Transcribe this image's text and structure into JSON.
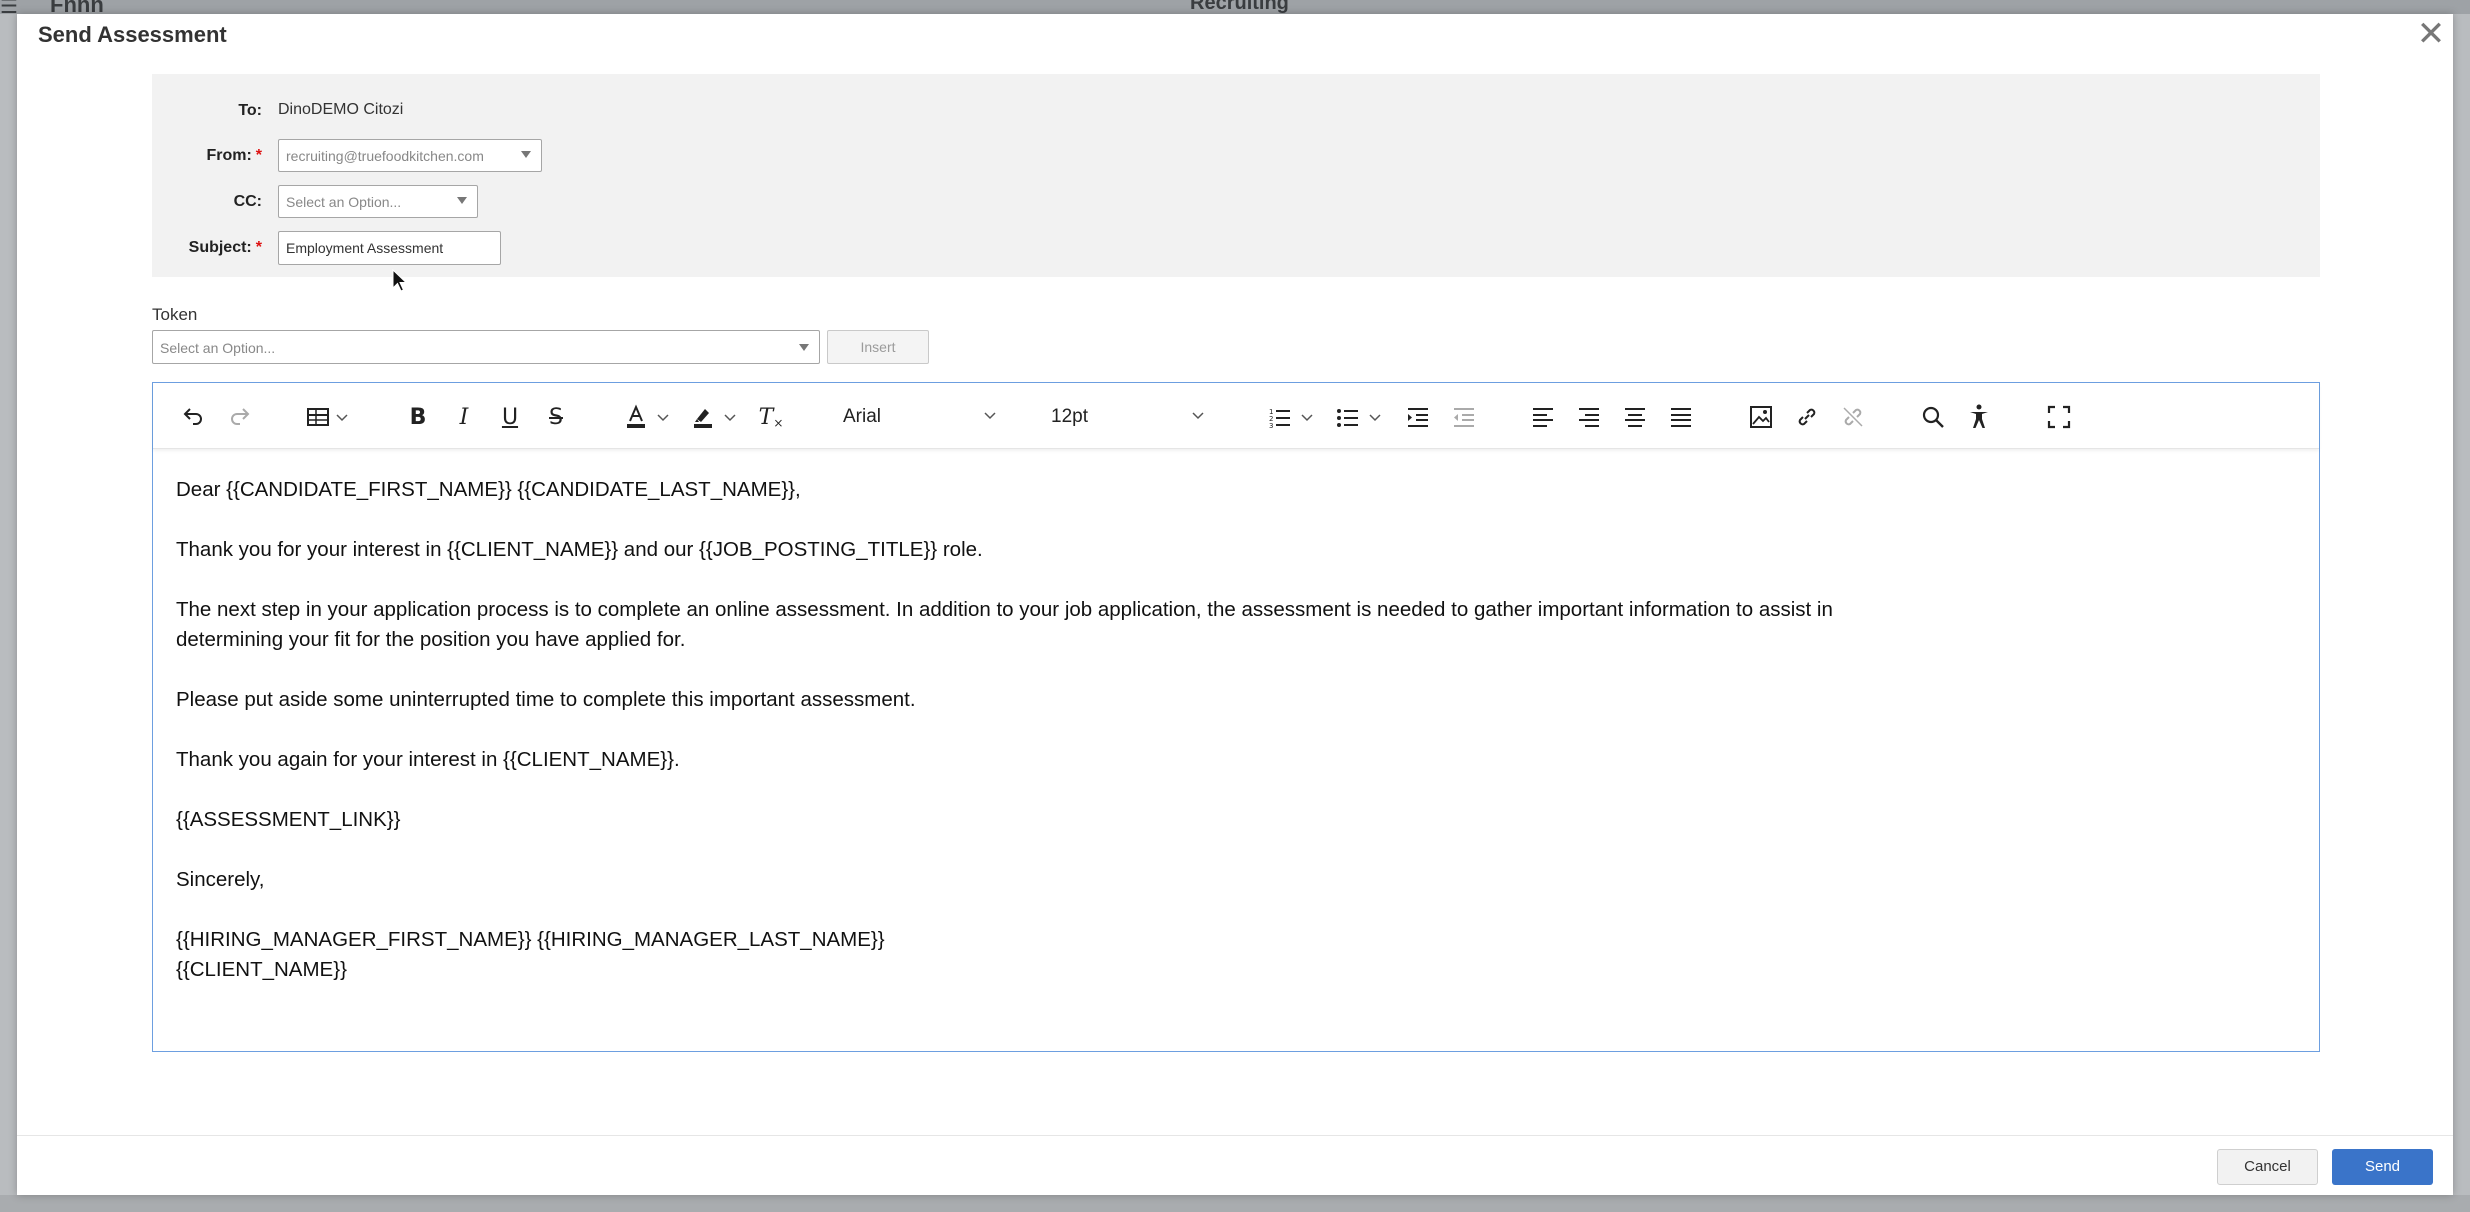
{
  "backdrop": {
    "brand": "Fnnn",
    "title": "Recruiting"
  },
  "modal": {
    "title": "Send Assessment",
    "close_icon": "close-icon"
  },
  "form": {
    "to_label": "To:",
    "to_value": "DinoDEMO Citozi",
    "from_label": "From:",
    "from_value": "recruiting@truefoodkitchen.com",
    "cc_label": "CC:",
    "cc_placeholder": "Select an Option...",
    "subject_label": "Subject:",
    "subject_value": "Employment Assessment",
    "required_mark": "*"
  },
  "token": {
    "label": "Token",
    "placeholder": "Select an Option...",
    "insert_label": "Insert"
  },
  "toolbar": {
    "font_family": "Arial",
    "font_size": "12pt",
    "icons": [
      "undo-icon",
      "redo-icon",
      "table-icon",
      "bold-icon",
      "italic-icon",
      "underline-icon",
      "strikethrough-icon",
      "text-color-icon",
      "highlight-icon",
      "clear-format-icon",
      "numbered-list-icon",
      "bullet-list-icon",
      "indent-icon",
      "outdent-icon",
      "align-left-icon",
      "align-right-icon",
      "align-center-icon",
      "justify-icon",
      "image-icon",
      "link-icon",
      "unlink-icon",
      "search-icon",
      "accessibility-icon",
      "fullscreen-icon"
    ]
  },
  "body": {
    "p1": "Dear {{CANDIDATE_FIRST_NAME}} {{CANDIDATE_LAST_NAME}},",
    "p2": "Thank you for your interest in {{CLIENT_NAME}} and our {{JOB_POSTING_TITLE}} role.",
    "p3a": "The next step in your application process is to complete an online assessment. In addition to your job application, the assessment is needed to gather important information to assist in",
    "p3b": "determining your fit for the position you have applied for.",
    "p4": "Please put aside some uninterrupted time to complete this important assessment.",
    "p5": "Thank you again for your interest in {{CLIENT_NAME}}.",
    "p6": "{{ASSESSMENT_LINK}}",
    "p7": "Sincerely,",
    "p8a": "{{HIRING_MANAGER_FIRST_NAME}} {{HIRING_MANAGER_LAST_NAME}}",
    "p8b": "{{CLIENT_NAME}}"
  },
  "footer": {
    "cancel_label": "Cancel",
    "send_label": "Send"
  },
  "colors": {
    "primary": "#3a74c9",
    "required": "#dd1111",
    "editor_border": "#6d9fe0"
  }
}
